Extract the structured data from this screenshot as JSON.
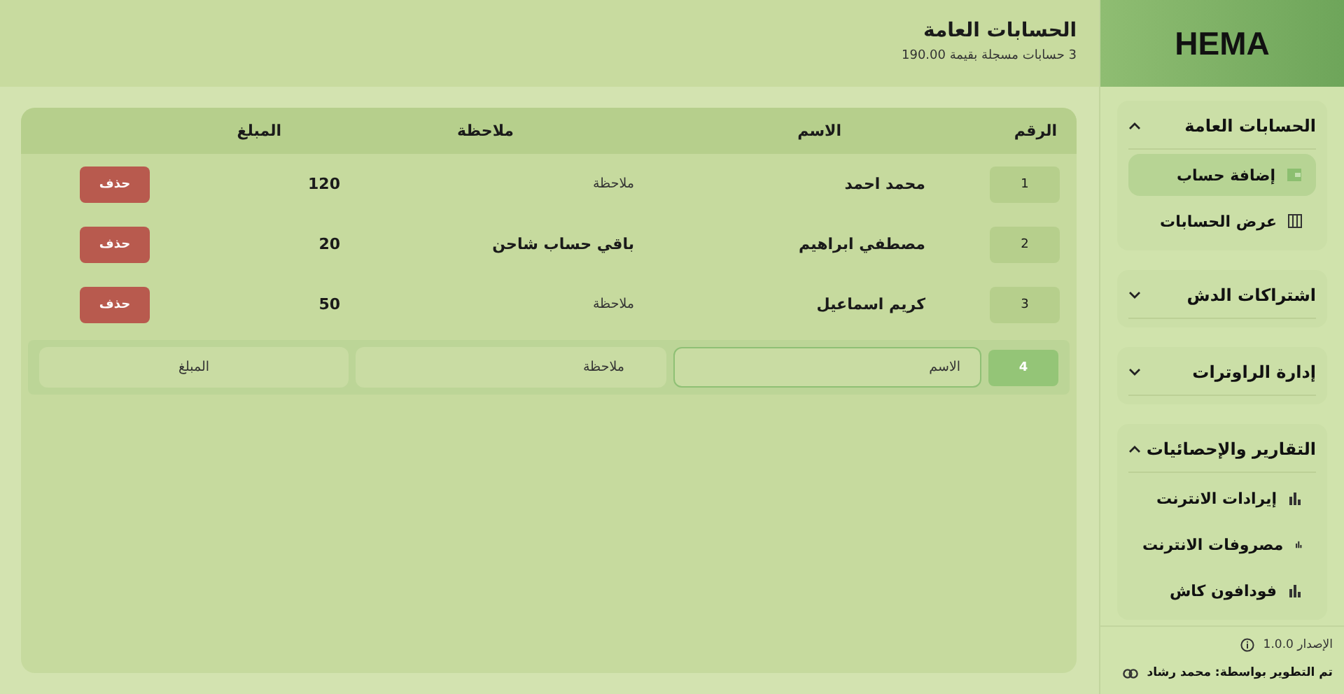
{
  "header": {
    "title": "الحسابات العامة",
    "subtitle": "3 حسابات مسجلة بقيمة 190.00"
  },
  "table": {
    "columns": [
      "الرقم",
      "الاسم",
      "ملاحظة",
      "المبلغ"
    ],
    "rows": [
      {
        "number": "1",
        "name": "محمد احمد",
        "note": "ملاحظة",
        "note_muted": true,
        "amount": "120",
        "action": "حذف"
      },
      {
        "number": "2",
        "name": "مصطفي ابراهيم",
        "note": "باقي حساب شاحن",
        "note_muted": false,
        "amount": "20",
        "action": "حذف"
      },
      {
        "number": "3",
        "name": "كريم اسماعيل",
        "note": "ملاحظة",
        "note_muted": true,
        "amount": "50",
        "action": "حذف"
      }
    ],
    "new_row": {
      "number": "4",
      "name": {
        "placeholder": "الاسم"
      },
      "note": {
        "placeholder": "ملاحظة"
      },
      "amount": {
        "placeholder": "المبلغ"
      }
    }
  },
  "sidebar": {
    "logo": "HEMA",
    "sections": [
      {
        "title": "الحسابات العامة",
        "expanded": true,
        "items": [
          {
            "label": "إضافة حساب",
            "kind": "wallet",
            "selected": true
          },
          {
            "label": "عرض الحسابات",
            "kind": "list",
            "selected": false
          }
        ]
      },
      {
        "title": "اشتراكات الدش",
        "expanded": false
      },
      {
        "title": "إدارة الراوترات",
        "expanded": false
      },
      {
        "title": "التقارير والإحصائيات",
        "expanded": true,
        "items": [
          {
            "label": "إيرادات الانترنت",
            "kind": "chart",
            "selected": false
          },
          {
            "label": "مصروفات الانترنت",
            "kind": "chart",
            "selected": false
          },
          {
            "label": "فودافون كاش",
            "kind": "chart",
            "selected": false
          }
        ]
      }
    ],
    "version": "الإصدار 1.0.0",
    "credit": "تم التطوير بواسطة: محمد رشاد"
  }
}
